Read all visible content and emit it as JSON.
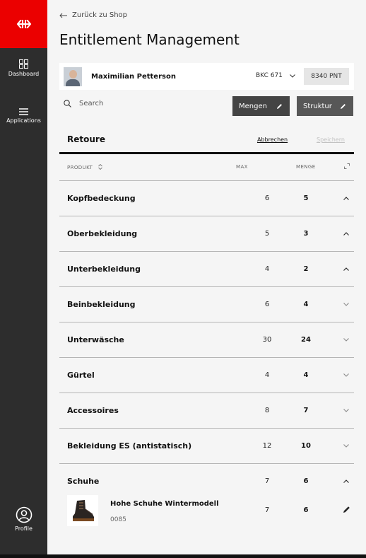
{
  "sidebar": {
    "logo_icon": "sbb-logo-icon",
    "items": [
      {
        "label": "Dashboard",
        "icon": "dashboard-icon"
      },
      {
        "label": "Applications",
        "icon": "menu-icon"
      }
    ],
    "profile": {
      "label": "Profile",
      "icon": "profile-icon"
    }
  },
  "header": {
    "back_label": "Zurück zu Shop",
    "title": "Entitlement Management"
  },
  "user": {
    "name": "Maximilian Petterson",
    "account": "BKC 671",
    "points": "8340 PNT"
  },
  "toolbar": {
    "search_placeholder": "Search",
    "mengen_label": "Mengen",
    "struktur_label": "Struktur"
  },
  "section": {
    "title": "Retoure",
    "cancel_label": "Abbrechen",
    "save_label": "Speichern"
  },
  "table": {
    "columns": {
      "product": "PRODUKT",
      "max": "MAX",
      "qty": "MENGE"
    },
    "rows": [
      {
        "category": "Kopfbedeckung",
        "max": "6",
        "qty": "5",
        "expanded": true
      },
      {
        "category": "Oberbekleidung",
        "max": "5",
        "qty": "3",
        "expanded": true
      },
      {
        "category": "Unterbekleidung",
        "max": "4",
        "qty": "2",
        "expanded": true
      },
      {
        "category": "Beinbekleidung",
        "max": "6",
        "qty": "4",
        "expanded": false
      },
      {
        "category": "Unterwäsche",
        "max": "30",
        "qty": "24",
        "expanded": false
      },
      {
        "category": "Gürtel",
        "max": "4",
        "qty": "4",
        "expanded": false
      },
      {
        "category": "Accessoires",
        "max": "8",
        "qty": "7",
        "expanded": false
      },
      {
        "category": "Bekleidung ES (antistatisch)",
        "max": "12",
        "qty": "10",
        "expanded": false
      },
      {
        "category": "Schuhe",
        "max": "7",
        "qty": "6",
        "expanded": true
      }
    ],
    "product": {
      "name": "Hohe Schuhe Wintermodell",
      "code": "0085",
      "max": "7",
      "qty": "6"
    }
  },
  "colors": {
    "brand_red": "#eb0000",
    "sidebar": "#2d2d2d",
    "button_dark": "#444444"
  }
}
